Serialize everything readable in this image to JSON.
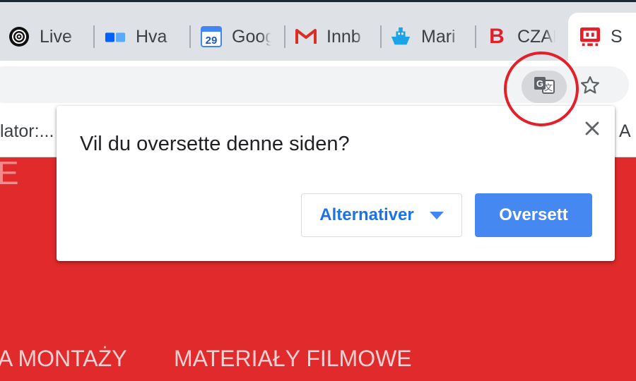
{
  "tabs": [
    {
      "title": "Live",
      "icon": "broadcast-icon"
    },
    {
      "title": "Hva",
      "icon": "folders-icon"
    },
    {
      "title": "Goog",
      "icon": "calendar-icon",
      "icon_text": "29"
    },
    {
      "title": "Innb",
      "icon": "gmail-icon"
    },
    {
      "title": "Mari",
      "icon": "ship-icon"
    },
    {
      "title": "CZAR",
      "icon": "b-logo-icon",
      "icon_text": "B"
    },
    {
      "title": "S",
      "icon": "site-logo-icon",
      "active": true
    }
  ],
  "bookmarks": {
    "left_item": "lator:...",
    "right_item": "A"
  },
  "page": {
    "partial_letter": "E",
    "nav_items": [
      "A MONTAŻY",
      "MATERIAŁY FILMOWE"
    ]
  },
  "translate_dialog": {
    "question": "Vil du oversette denne siden?",
    "options_button": "Alternativer",
    "translate_button": "Oversett"
  },
  "colors": {
    "page_red": "#e02a2c",
    "primary_blue": "#4688f1",
    "annotation_circle": "#e3202a"
  }
}
